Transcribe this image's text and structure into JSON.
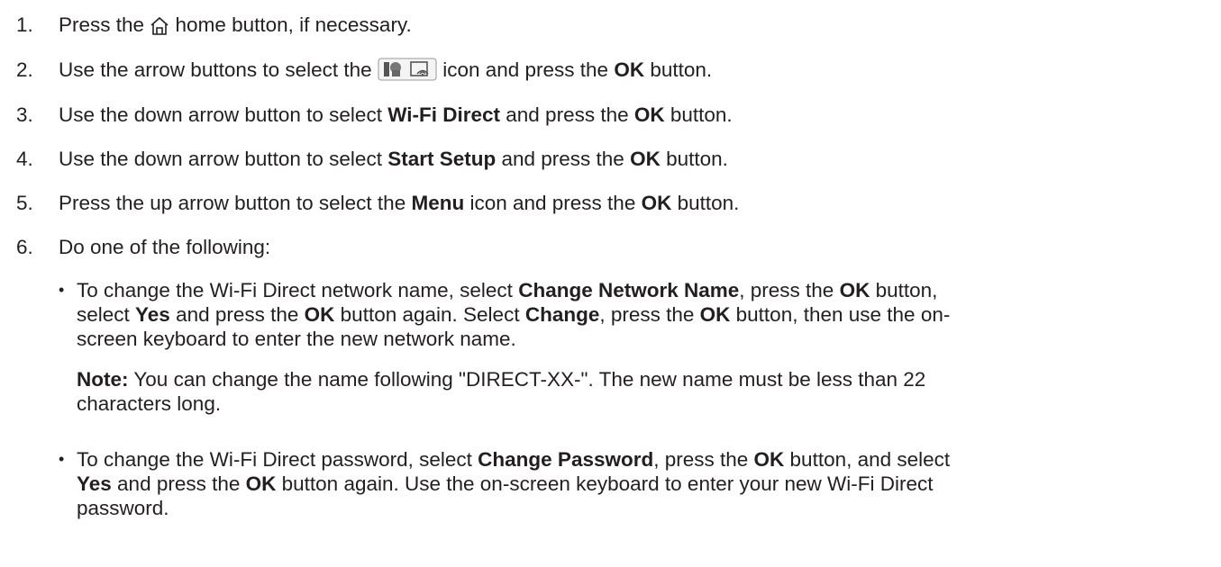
{
  "steps": [
    {
      "num": "1.",
      "parts": [
        "Press the ",
        "",
        " home button, if necessary."
      ]
    },
    {
      "num": "2.",
      "parts": [
        "Use the arrow buttons to select the ",
        "",
        " icon and press the ",
        "OK",
        " button."
      ]
    },
    {
      "num": "3.",
      "parts": [
        "Use the down arrow button to select ",
        "Wi-Fi Direct",
        " and press the ",
        "OK",
        " button."
      ]
    },
    {
      "num": "4.",
      "parts": [
        "Use the down arrow button to select ",
        "Start Setup",
        " and press the ",
        "OK",
        " button."
      ]
    },
    {
      "num": "5.",
      "parts": [
        "Press the up arrow button to select the ",
        "Menu",
        " icon and press the ",
        "OK",
        " button."
      ]
    },
    {
      "num": "6.",
      "parts": [
        "Do one of the following:"
      ]
    }
  ],
  "bullet1": {
    "line1": [
      "To change the Wi-Fi Direct network name, select ",
      "Change Network Name",
      ", press the ",
      "OK",
      " button,"
    ],
    "line2": [
      "select ",
      "Yes",
      " and press the ",
      "OK",
      " button again. Select ",
      "Change",
      ", press the ",
      "OK",
      " button, then use the on-"
    ],
    "line3": [
      "screen keyboard to enter the new network name."
    ]
  },
  "note": {
    "label": "Note:",
    "line1": " You can change the name following \"DIRECT-XX-\". The new name must be less than 22",
    "line2": "characters long."
  },
  "bullet2": {
    "line1": [
      "To change the Wi-Fi Direct password, select ",
      "Change Password",
      ", press the ",
      "OK",
      " button, and select"
    ],
    "line2": [
      "Yes",
      " and press the ",
      "OK",
      " button again. Use the on-screen keyboard to enter your new Wi-Fi Direct"
    ],
    "line3": [
      "password."
    ]
  },
  "bullet_char": "•",
  "icons": [
    "home-icon",
    "network-status-icon"
  ]
}
